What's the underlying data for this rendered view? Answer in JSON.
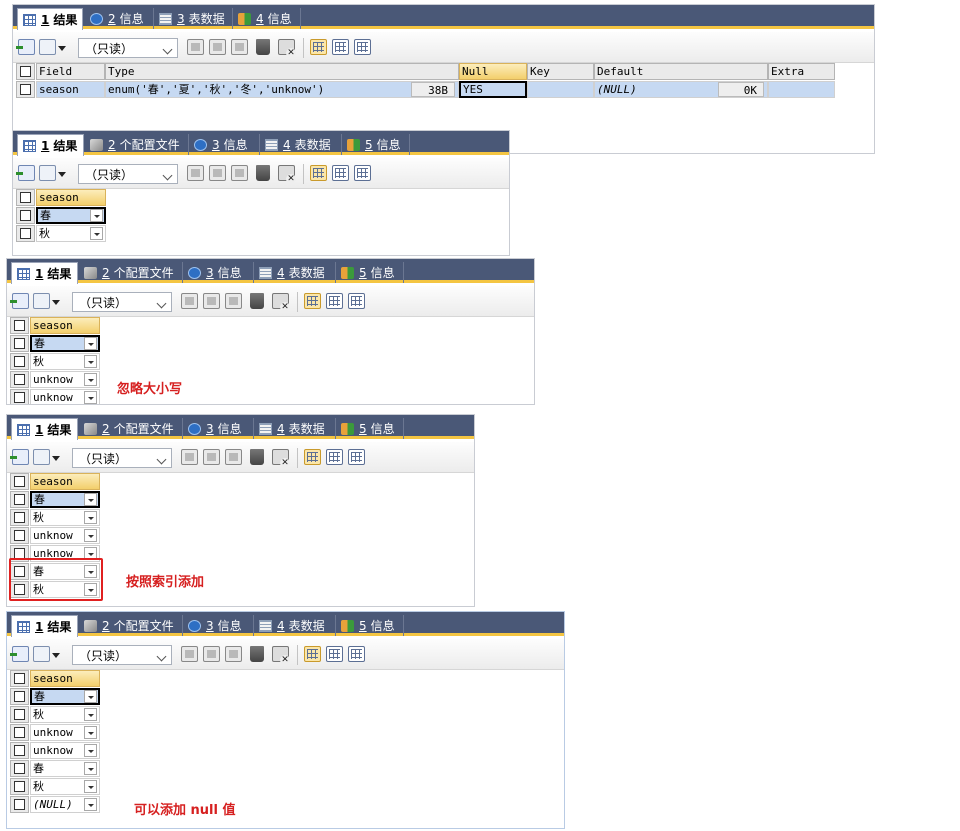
{
  "tabs_a": [
    {
      "num": "1",
      "label": "结果",
      "icon": "grid-icon"
    },
    {
      "num": "2",
      "label": "信息",
      "icon": "info-icon"
    },
    {
      "num": "3",
      "label": "表数据",
      "icon": "table-icon"
    },
    {
      "num": "4",
      "label": "信息",
      "icon": "message-icon"
    }
  ],
  "tabs_b": [
    {
      "num": "1",
      "label": "结果",
      "icon": "grid-icon"
    },
    {
      "num": "2",
      "label": "个配置文件",
      "icon": "profile-icon"
    },
    {
      "num": "3",
      "label": "信息",
      "icon": "info-icon"
    },
    {
      "num": "4",
      "label": "表数据",
      "icon": "table-icon"
    },
    {
      "num": "5",
      "label": "信息",
      "icon": "message-icon"
    }
  ],
  "readonly_label": "（只读）",
  "field_table": {
    "headers": [
      "Field",
      "Type",
      "Null",
      "Key",
      "Default",
      "Extra"
    ],
    "row": {
      "field": "season",
      "type": "enum('春','夏','秋','冬','unknow')",
      "type_size": "38B",
      "null": "YES",
      "key": "",
      "default": "(NULL)",
      "default_size": "0K",
      "extra": ""
    }
  },
  "column_header": "season",
  "panels": [
    {
      "rows": [
        "春",
        "秋"
      ],
      "note": ""
    },
    {
      "rows": [
        "春",
        "秋",
        "unknow",
        "unknow"
      ],
      "note": "忽略大小写"
    },
    {
      "rows": [
        "春",
        "秋",
        "unknow",
        "unknow",
        "春",
        "秋"
      ],
      "note": "按照索引添加"
    },
    {
      "rows": [
        "春",
        "秋",
        "unknow",
        "unknow",
        "春",
        "秋",
        "(NULL)"
      ],
      "note": "可以添加 null 值"
    }
  ],
  "colors": {
    "tabbar": "#4a5877",
    "accent": "#f4c542",
    "annotation": "#d62020",
    "selected_row": "#c6d9f2"
  }
}
